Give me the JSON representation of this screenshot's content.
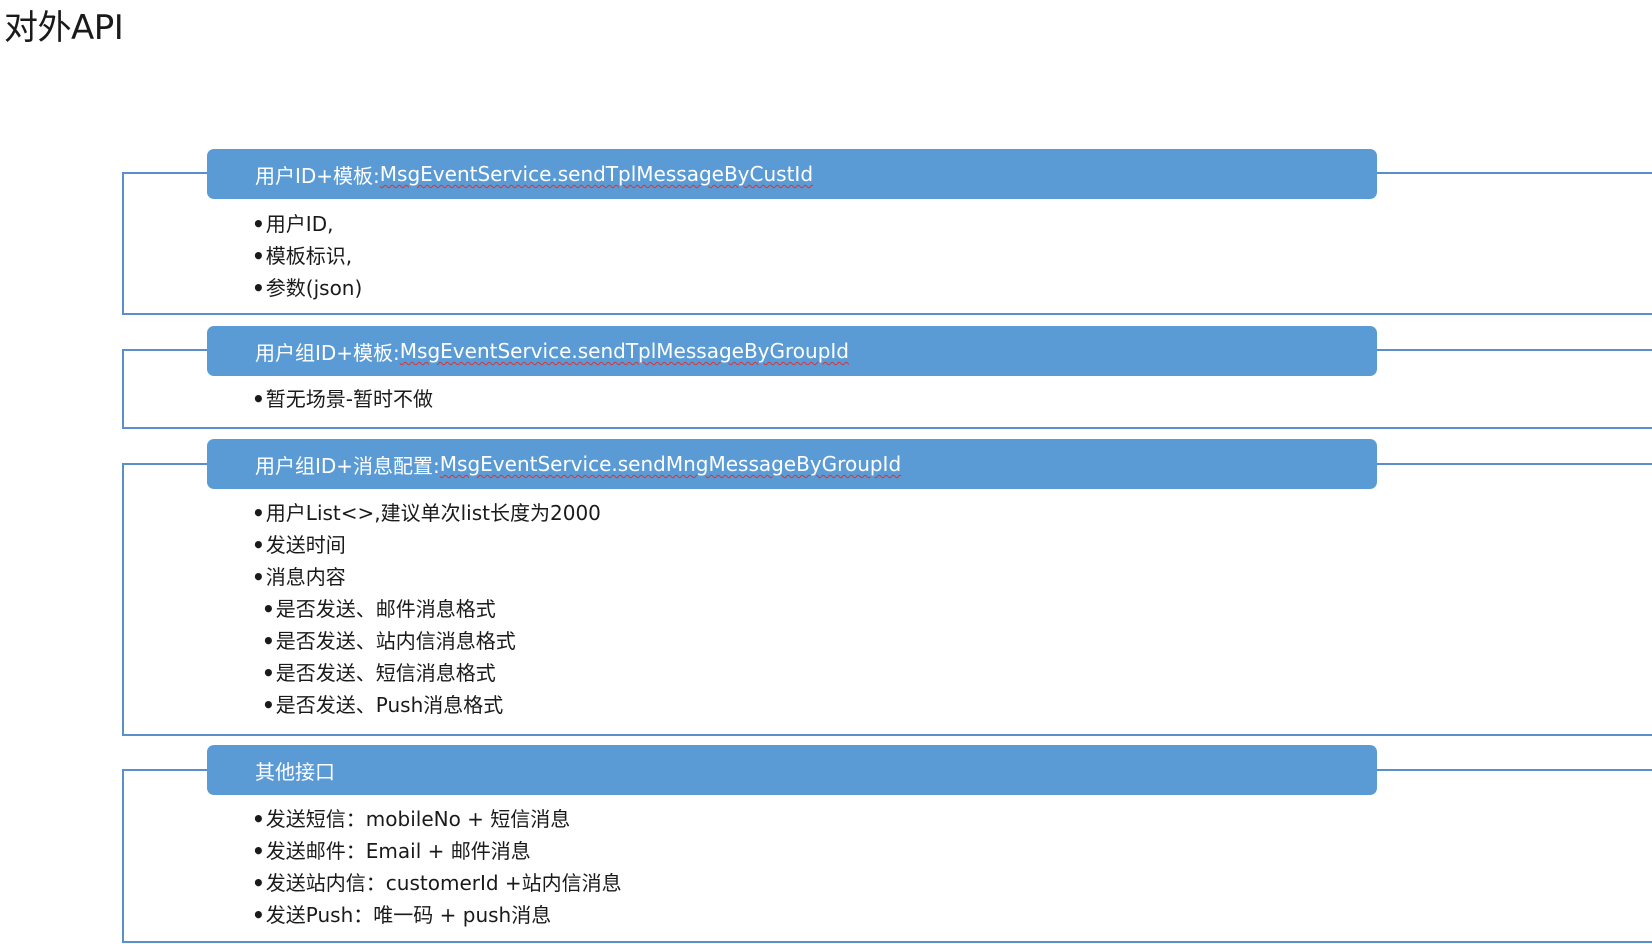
{
  "page": {
    "title": "对外API"
  },
  "sections": [
    {
      "header_prefix": "用户ID+模板:",
      "header_method": "MsgEventService.sendTplMessageByCustId",
      "items": [
        {
          "text": "用户ID,",
          "level": 1
        },
        {
          "text": "模板标识,",
          "level": 1
        },
        {
          "text": "参数(json)",
          "level": 1
        }
      ]
    },
    {
      "header_prefix": "用户组ID+模板:",
      "header_method": "MsgEventService.sendTplMessageByGroupId",
      "items": [
        {
          "text": "暂无场景-暂时不做",
          "level": 1
        }
      ]
    },
    {
      "header_prefix": "用户组ID+消息配置:",
      "header_method": "MsgEventService.sendMngMessageByGroupId",
      "items": [
        {
          "text": "用户List<>,建议单次list长度为2000",
          "level": 1
        },
        {
          "text": "发送时间",
          "level": 1
        },
        {
          "text": "消息内容",
          "level": 1
        },
        {
          "text": "是否发送、邮件消息格式",
          "level": 2
        },
        {
          "text": "是否发送、站内信消息格式",
          "level": 2
        },
        {
          "text": "是否发送、短信消息格式",
          "level": 2
        },
        {
          "text": "是否发送、Push消息格式",
          "level": 2
        }
      ]
    },
    {
      "header_prefix": "其他接口",
      "header_method": "",
      "items": [
        {
          "text": "发送短信：mobileNo + 短信消息",
          "level": 1
        },
        {
          "text": "发送邮件：Email + 邮件消息",
          "level": 1
        },
        {
          "text": "发送站内信：customerId +站内信消息",
          "level": 1
        },
        {
          "text": "发送Push：唯一码 + push消息",
          "level": 1
        }
      ]
    }
  ],
  "colors": {
    "bar_fill": "#5b9bd5",
    "frame_line": "#5b8fcb",
    "spell_underline": "#e03030"
  },
  "icons": {
    "bullet": "bullet-dot-icon"
  }
}
